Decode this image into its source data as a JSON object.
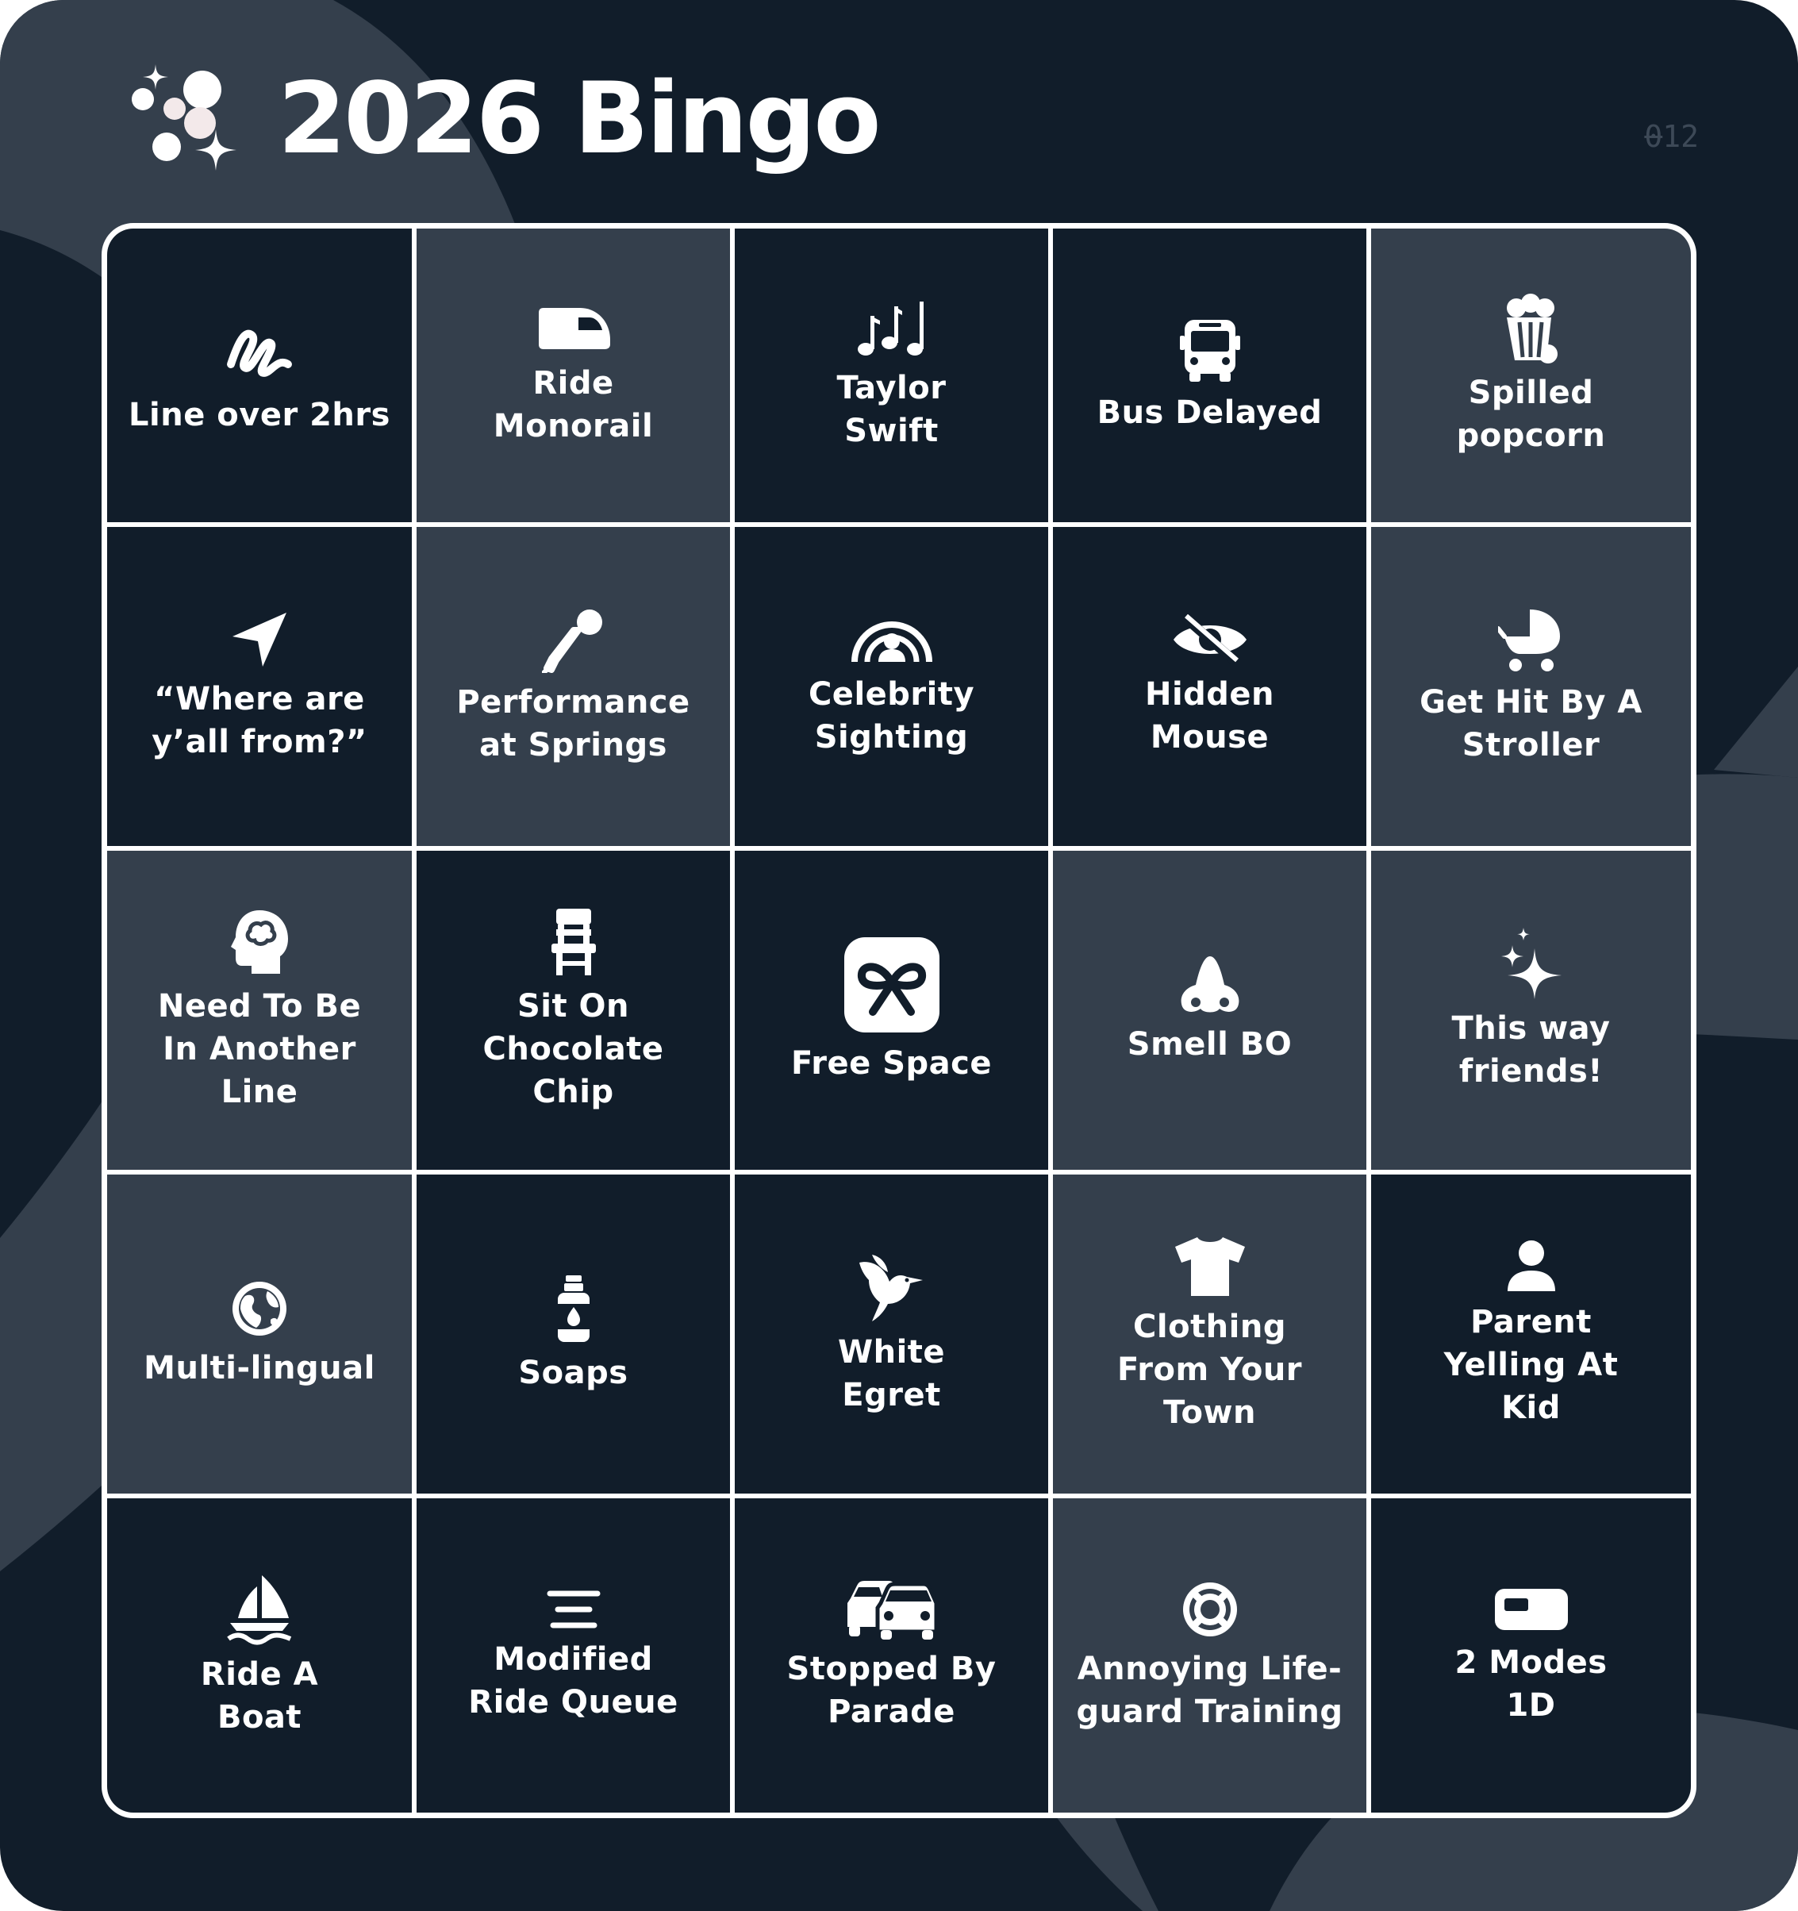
{
  "header": {
    "title": "2026 Bingo",
    "card_number": "012",
    "logo_icon": "sparkles-bubbles-icon"
  },
  "colors": {
    "background": "#111d2a",
    "cell_light": "#343f4c",
    "grid_lines": "#ffffff",
    "text": "#ffffff",
    "code_text": "#3d4957"
  },
  "board": {
    "cells": [
      {
        "label": "Line over 2hrs",
        "icon": "squiggle-icon",
        "shade": "dark"
      },
      {
        "label": "Ride\nMonorail",
        "icon": "monorail-icon",
        "shade": "light"
      },
      {
        "label": "Taylor\nSwift",
        "icon": "music-notes-icon",
        "shade": "dark"
      },
      {
        "label": "Bus Delayed",
        "icon": "bus-icon",
        "shade": "dark"
      },
      {
        "label": "Spilled\npopcorn",
        "icon": "popcorn-icon",
        "shade": "light"
      },
      {
        "label": "“Where are\ny’all from?”",
        "icon": "location-arrow-icon",
        "shade": "dark"
      },
      {
        "label": "Performance\nat Springs",
        "icon": "microphone-icon",
        "shade": "light"
      },
      {
        "label": "Celebrity\nSighting",
        "icon": "celebrity-icon",
        "shade": "dark"
      },
      {
        "label": "Hidden\nMouse",
        "icon": "eye-slash-icon",
        "shade": "dark"
      },
      {
        "label": "Get Hit By A\nStroller",
        "icon": "stroller-icon",
        "shade": "light"
      },
      {
        "label": "Need To Be\nIn Another\nLine",
        "icon": "head-brain-icon",
        "shade": "light"
      },
      {
        "label": "Sit On\nChocolate\nChip",
        "icon": "chair-icon",
        "shade": "dark"
      },
      {
        "label": "Free Space",
        "icon": "gift-icon",
        "shade": "dark"
      },
      {
        "label": "Smell BO",
        "icon": "nose-icon",
        "shade": "light"
      },
      {
        "label": "This way\nfriends!",
        "icon": "sparkles-icon",
        "shade": "light"
      },
      {
        "label": "Multi-lingual",
        "icon": "globe-icon",
        "shade": "light"
      },
      {
        "label": "Soaps",
        "icon": "soap-bottle-icon",
        "shade": "dark"
      },
      {
        "label": "White\nEgret",
        "icon": "bird-icon",
        "shade": "dark"
      },
      {
        "label": "Clothing\nFrom Your\nTown",
        "icon": "tshirt-icon",
        "shade": "light"
      },
      {
        "label": "Parent\nYelling At\nKid",
        "icon": "person-icon",
        "shade": "dark"
      },
      {
        "label": "Ride A\nBoat",
        "icon": "sailboat-icon",
        "shade": "dark"
      },
      {
        "label": "Modified\nRide Queue",
        "icon": "align-center-icon",
        "shade": "dark"
      },
      {
        "label": "Stopped By\nParade",
        "icon": "cars-icon",
        "shade": "dark"
      },
      {
        "label": "Annoying Life-\nguard Training",
        "icon": "life-ring-icon",
        "shade": "light"
      },
      {
        "label": "2 Modes\n1D",
        "icon": "rv-icon",
        "shade": "dark"
      }
    ]
  }
}
